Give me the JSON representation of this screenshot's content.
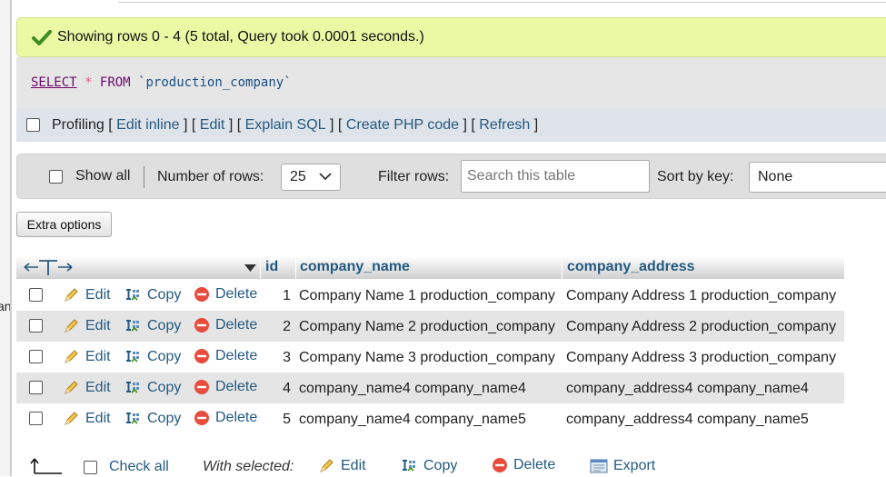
{
  "left_clip_text": "an",
  "success_message": "Showing rows 0 - 4 (5 total, Query took 0.0001 seconds.)",
  "sql": {
    "select": "SELECT",
    "star": "*",
    "from": "FROM",
    "table": "`production_company`"
  },
  "profiling": {
    "label": "Profiling",
    "links": [
      "Edit inline",
      "Edit",
      "Explain SQL",
      "Create PHP code",
      "Refresh"
    ]
  },
  "navigation": {
    "show_all": "Show all",
    "number_of_rows_label": "Number of rows:",
    "number_of_rows_value": "25",
    "filter_rows_label": "Filter rows:",
    "search_placeholder": "Search this table",
    "sort_by_key_label": "Sort by key:",
    "sort_by_key_value": "None"
  },
  "extra_options": "Extra options",
  "table": {
    "columns": [
      "id",
      "company_name",
      "company_address"
    ],
    "actions": {
      "edit": "Edit",
      "copy": "Copy",
      "delete": "Delete"
    },
    "rows": [
      {
        "id": "1",
        "company_name": "Company Name 1 production_company",
        "company_address": "Company Address 1 production_company"
      },
      {
        "id": "2",
        "company_name": "Company Name 2 production_company",
        "company_address": "Company Address 2 production_company"
      },
      {
        "id": "3",
        "company_name": "Company Name 3 production_company",
        "company_address": "Company Address 3 production_company"
      },
      {
        "id": "4",
        "company_name": "company_name4 company_name4",
        "company_address": "company_address4 company_name4"
      },
      {
        "id": "5",
        "company_name": "company_name4 company_name5",
        "company_address": "company_address4 company_name5"
      }
    ]
  },
  "bulk": {
    "check_all": "Check all",
    "with_selected": "With selected:",
    "edit": "Edit",
    "copy": "Copy",
    "delete": "Delete",
    "export": "Export"
  },
  "colors": {
    "link": "#235a81",
    "success_bg": "#ebf8a4",
    "alt_row": "#e5e5e5",
    "delete_red": "#e74c3c"
  }
}
